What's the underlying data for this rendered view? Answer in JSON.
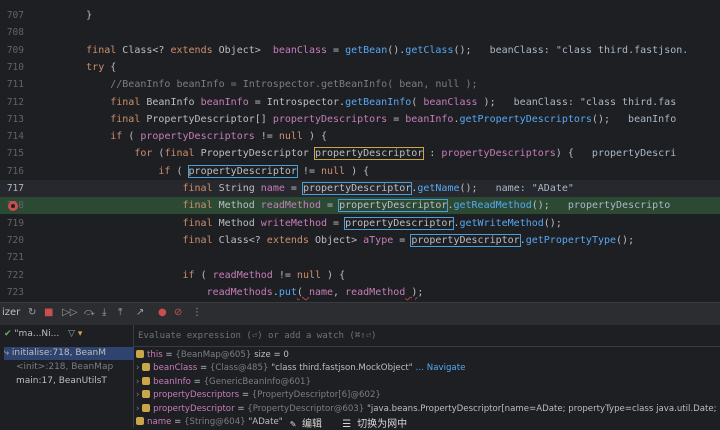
{
  "editor": {
    "lines": [
      {
        "num": "707",
        "parts": [
          [
            "p",
            "        }"
          ]
        ]
      },
      {
        "num": "708",
        "parts": []
      },
      {
        "num": "709",
        "parts": [
          [
            "k",
            "        final "
          ],
          [
            "ty",
            "Class<? "
          ],
          [
            "k",
            "extends "
          ],
          [
            "ty",
            "Object>  "
          ],
          [
            "v",
            "beanClass"
          ],
          [
            "p",
            " = "
          ],
          [
            "f",
            "getBean"
          ],
          [
            "p",
            "()."
          ],
          [
            "f",
            "getClass"
          ],
          [
            "p",
            "();  "
          ],
          [
            "inl",
            " beanClass: \"class third.fastjson."
          ]
        ]
      },
      {
        "num": "710",
        "parts": [
          [
            "k",
            "        try "
          ],
          [
            "p",
            "{"
          ]
        ]
      },
      {
        "num": "711",
        "parts": [
          [
            "cmt",
            "            //BeanInfo beanInfo = Introspector.getBeanInfo( bean, null );"
          ]
        ]
      },
      {
        "num": "712",
        "parts": [
          [
            "k",
            "            final "
          ],
          [
            "ty",
            "BeanInfo "
          ],
          [
            "v",
            "beanInfo"
          ],
          [
            "p",
            " = Introspector."
          ],
          [
            "f",
            "getBeanInfo"
          ],
          [
            "p",
            "( "
          ],
          [
            "v",
            "beanClass"
          ],
          [
            "p",
            " );  "
          ],
          [
            "inl",
            " beanClass: \"class third.fas"
          ]
        ]
      },
      {
        "num": "713",
        "parts": [
          [
            "k",
            "            final "
          ],
          [
            "ty",
            "PropertyDescriptor[] "
          ],
          [
            "v",
            "propertyDescriptors"
          ],
          [
            "p",
            " = "
          ],
          [
            "v",
            "beanInfo"
          ],
          [
            "p",
            "."
          ],
          [
            "f",
            "getPropertyDescriptors"
          ],
          [
            "p",
            "();  "
          ],
          [
            "inl",
            " beanInfo"
          ]
        ]
      },
      {
        "num": "714",
        "parts": [
          [
            "k",
            "            if "
          ],
          [
            "p",
            "( "
          ],
          [
            "v",
            "propertyDescriptors"
          ],
          [
            "p",
            " != "
          ],
          [
            "k",
            "null "
          ],
          [
            "p",
            ") {"
          ]
        ]
      },
      {
        "num": "715",
        "parts": [
          [
            "k",
            "                for "
          ],
          [
            "p",
            "("
          ],
          [
            "k",
            "final "
          ],
          [
            "ty",
            "PropertyDescriptor "
          ],
          [
            "boxy",
            "propertyDescriptor"
          ],
          [
            "p",
            " : "
          ],
          [
            "v",
            "propertyDescriptors"
          ],
          [
            "p",
            ") {  "
          ],
          [
            "inl",
            " propertyDescri"
          ]
        ]
      },
      {
        "num": "716",
        "parts": [
          [
            "k",
            "                    if "
          ],
          [
            "p",
            "( "
          ],
          [
            "box",
            "propertyDescriptor"
          ],
          [
            "p",
            " != "
          ],
          [
            "k",
            "null "
          ],
          [
            "p",
            ") {"
          ]
        ]
      },
      {
        "num": "717",
        "parts": [
          [
            "k",
            "                        final "
          ],
          [
            "ty",
            "String "
          ],
          [
            "v",
            "name"
          ],
          [
            "p",
            " = "
          ],
          [
            "box",
            "propertyDescriptor"
          ],
          [
            "p",
            "."
          ],
          [
            "f",
            "getName"
          ],
          [
            "p",
            "();  "
          ],
          [
            "inl",
            " name: \"ADate\""
          ]
        ]
      },
      {
        "num": "718",
        "parts": [
          [
            "k",
            "                        final "
          ],
          [
            "ty",
            "Method "
          ],
          [
            "v",
            "readMethod"
          ],
          [
            "p",
            " = "
          ],
          [
            "box",
            "propertyDescriptor"
          ],
          [
            "p",
            "."
          ],
          [
            "f",
            "getReadMethod"
          ],
          [
            "p",
            "();  "
          ],
          [
            "inl",
            " propertyDescripto"
          ]
        ]
      },
      {
        "num": "719",
        "parts": [
          [
            "k",
            "                        final "
          ],
          [
            "ty",
            "Method "
          ],
          [
            "v",
            "writeMethod"
          ],
          [
            "p",
            " = "
          ],
          [
            "box",
            "propertyDescriptor"
          ],
          [
            "p",
            "."
          ],
          [
            "f",
            "getWriteMethod"
          ],
          [
            "p",
            "();"
          ]
        ]
      },
      {
        "num": "720",
        "parts": [
          [
            "k",
            "                        final "
          ],
          [
            "ty",
            "Class<? "
          ],
          [
            "k",
            "extends "
          ],
          [
            "ty",
            "Object> "
          ],
          [
            "v",
            "aType"
          ],
          [
            "p",
            " = "
          ],
          [
            "box",
            "propertyDescriptor"
          ],
          [
            "p",
            "."
          ],
          [
            "f",
            "getPropertyType"
          ],
          [
            "p",
            "();"
          ]
        ]
      },
      {
        "num": "721",
        "parts": []
      },
      {
        "num": "722",
        "parts": [
          [
            "k",
            "                        if "
          ],
          [
            "p",
            "( "
          ],
          [
            "v",
            "readMethod"
          ],
          [
            "p",
            " != "
          ],
          [
            "k",
            "null "
          ],
          [
            "p",
            ") {"
          ]
        ]
      },
      {
        "num": "723",
        "parts": [
          [
            "v",
            "                            readMethods"
          ],
          [
            "p",
            "."
          ],
          [
            "f",
            "put"
          ],
          [
            "und",
            "( "
          ],
          [
            "v",
            "name"
          ],
          [
            "p",
            ", "
          ],
          [
            "v",
            "readMethod"
          ],
          [
            "und",
            " )"
          ],
          [
            "p",
            ";"
          ]
        ]
      }
    ]
  },
  "toolbar": {
    "left_label": "izer",
    "thread_label": "\"ma...Ni..."
  },
  "frames": [
    {
      "label": "initialise:718, BeanM"
    },
    {
      "label": "<init>:218, BeanMap"
    },
    {
      "label": "main:17, BeanUtilsT"
    }
  ],
  "eval_placeholder": "Evaluate expression (⏎) or add a watch (⌘⇧⏎)",
  "vars": [
    {
      "name": "this",
      "type": "{BeanMap@605}",
      "value": "size = 0",
      "link": ""
    },
    {
      "name": "beanClass",
      "type": "{Class@485}",
      "value": "\"class third.fastjson.MockObject\"",
      "link": "Navigate"
    },
    {
      "name": "beanInfo",
      "type": "{GenericBeanInfo@601}",
      "value": "",
      "link": ""
    },
    {
      "name": "propertyDescriptors",
      "type": "{PropertyDescriptor[6]@602}",
      "value": "",
      "link": ""
    },
    {
      "name": "propertyDescriptor",
      "type": "{PropertyDescriptor@603}",
      "value": "\"java.beans.PropertyDescriptor[name=ADate; propertyType=class java.util.Date; readM",
      "link": ""
    },
    {
      "name": "name",
      "type": "{String@604}",
      "value": "\"ADate\"",
      "link": ""
    }
  ],
  "overlay": {
    "edit": "✎ 编辑",
    "switch": "☰ 切换为网中"
  }
}
